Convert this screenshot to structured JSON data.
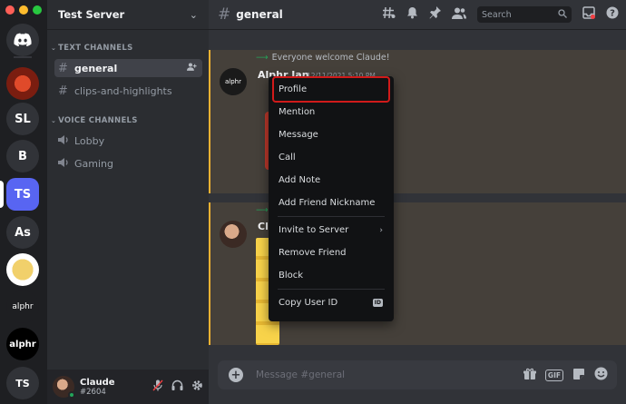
{
  "server": {
    "name": "Test Server"
  },
  "rail": {
    "servers": [
      {
        "id": "home",
        "label": ""
      },
      {
        "id": "s1",
        "label": ""
      },
      {
        "id": "s2",
        "label": "SL"
      },
      {
        "id": "s3",
        "label": "B"
      },
      {
        "id": "s4",
        "label": "TS"
      },
      {
        "id": "s5",
        "label": "As"
      },
      {
        "id": "s6",
        "label": ""
      },
      {
        "id": "s7",
        "label": "alphr"
      },
      {
        "id": "s8",
        "label": "alphr"
      },
      {
        "id": "s9",
        "label": "TS"
      }
    ]
  },
  "categories": {
    "text": "TEXT CHANNELS",
    "voice": "VOICE CHANNELS"
  },
  "channels": {
    "text": [
      {
        "name": "general"
      },
      {
        "name": "clips-and-highlights"
      }
    ],
    "voice": [
      {
        "name": "Lobby"
      },
      {
        "name": "Gaming"
      }
    ]
  },
  "user": {
    "name": "Claude",
    "tag": "#2604"
  },
  "topbar": {
    "channel": "general",
    "search_placeholder": "Search"
  },
  "messages": {
    "system_1": "Everyone welcome Claude!",
    "author_1": "Alphr Jan",
    "timestamp_1": "12/11/2021 5:10 PM",
    "author_2": "Cl"
  },
  "composer": {
    "placeholder": "Message #general",
    "gif_label": "GIF"
  },
  "context_menu": {
    "items_group1": [
      "Profile",
      "Mention",
      "Message",
      "Call",
      "Add Note",
      "Add Friend Nickname"
    ],
    "items_group2": [
      "Invite to Server",
      "Remove Friend",
      "Block"
    ],
    "items_group3": [
      "Copy User ID"
    ],
    "id_badge": "ID",
    "highlighted": "Profile"
  },
  "colors": {
    "accent": "#5865f2",
    "highlight_border": "#d11a1a",
    "mention_bar": "#f0b232",
    "online": "#23a55a"
  },
  "icons": [
    "discord-logo-icon",
    "chevron-down-icon",
    "hash-icon",
    "add-member-icon",
    "speaker-icon",
    "threads-icon",
    "bell-icon",
    "pin-icon",
    "members-icon",
    "search-icon",
    "inbox-icon",
    "help-icon",
    "mic-muted-icon",
    "headphones-icon",
    "gear-icon",
    "plus-icon",
    "gift-icon",
    "gif-icon",
    "sticker-icon",
    "emoji-icon",
    "chevron-right-icon"
  ]
}
